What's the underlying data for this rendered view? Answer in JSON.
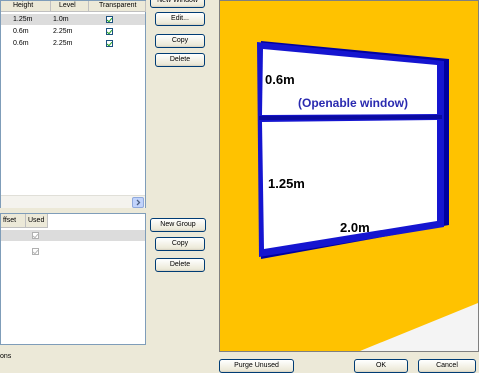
{
  "windows_table": {
    "columns": [
      "Height",
      "Level",
      "Transparent"
    ],
    "rows": [
      {
        "height": "1.25m",
        "level": "1.0m",
        "transparent": true
      },
      {
        "height": "0.6m",
        "level": "2.25m",
        "transparent": true
      },
      {
        "height": "0.6m",
        "level": "2.25m",
        "transparent": true
      }
    ]
  },
  "buttons_top": {
    "new_window": "New Window",
    "edit": "Edit...",
    "copy": "Copy",
    "delete": "Delete"
  },
  "groups_table": {
    "columns": [
      "ffset",
      "Used"
    ],
    "rows": [
      {
        "used": true
      },
      {
        "used": true
      }
    ]
  },
  "buttons_group": {
    "new_group": "New Group",
    "copy": "Copy",
    "delete": "Delete"
  },
  "footer": {
    "left_label": "ons",
    "purge": "Purge Unused",
    "ok": "OK",
    "cancel": "Cancel"
  },
  "preview": {
    "top_height": "0.6m",
    "top_note": "(Openable window)",
    "bottom_height": "1.25m",
    "width": "2.0m",
    "colors": {
      "background": "#ffc200",
      "frame": "#1010c8",
      "pane": "#ffffff",
      "floor": "#f4f4f4"
    }
  }
}
